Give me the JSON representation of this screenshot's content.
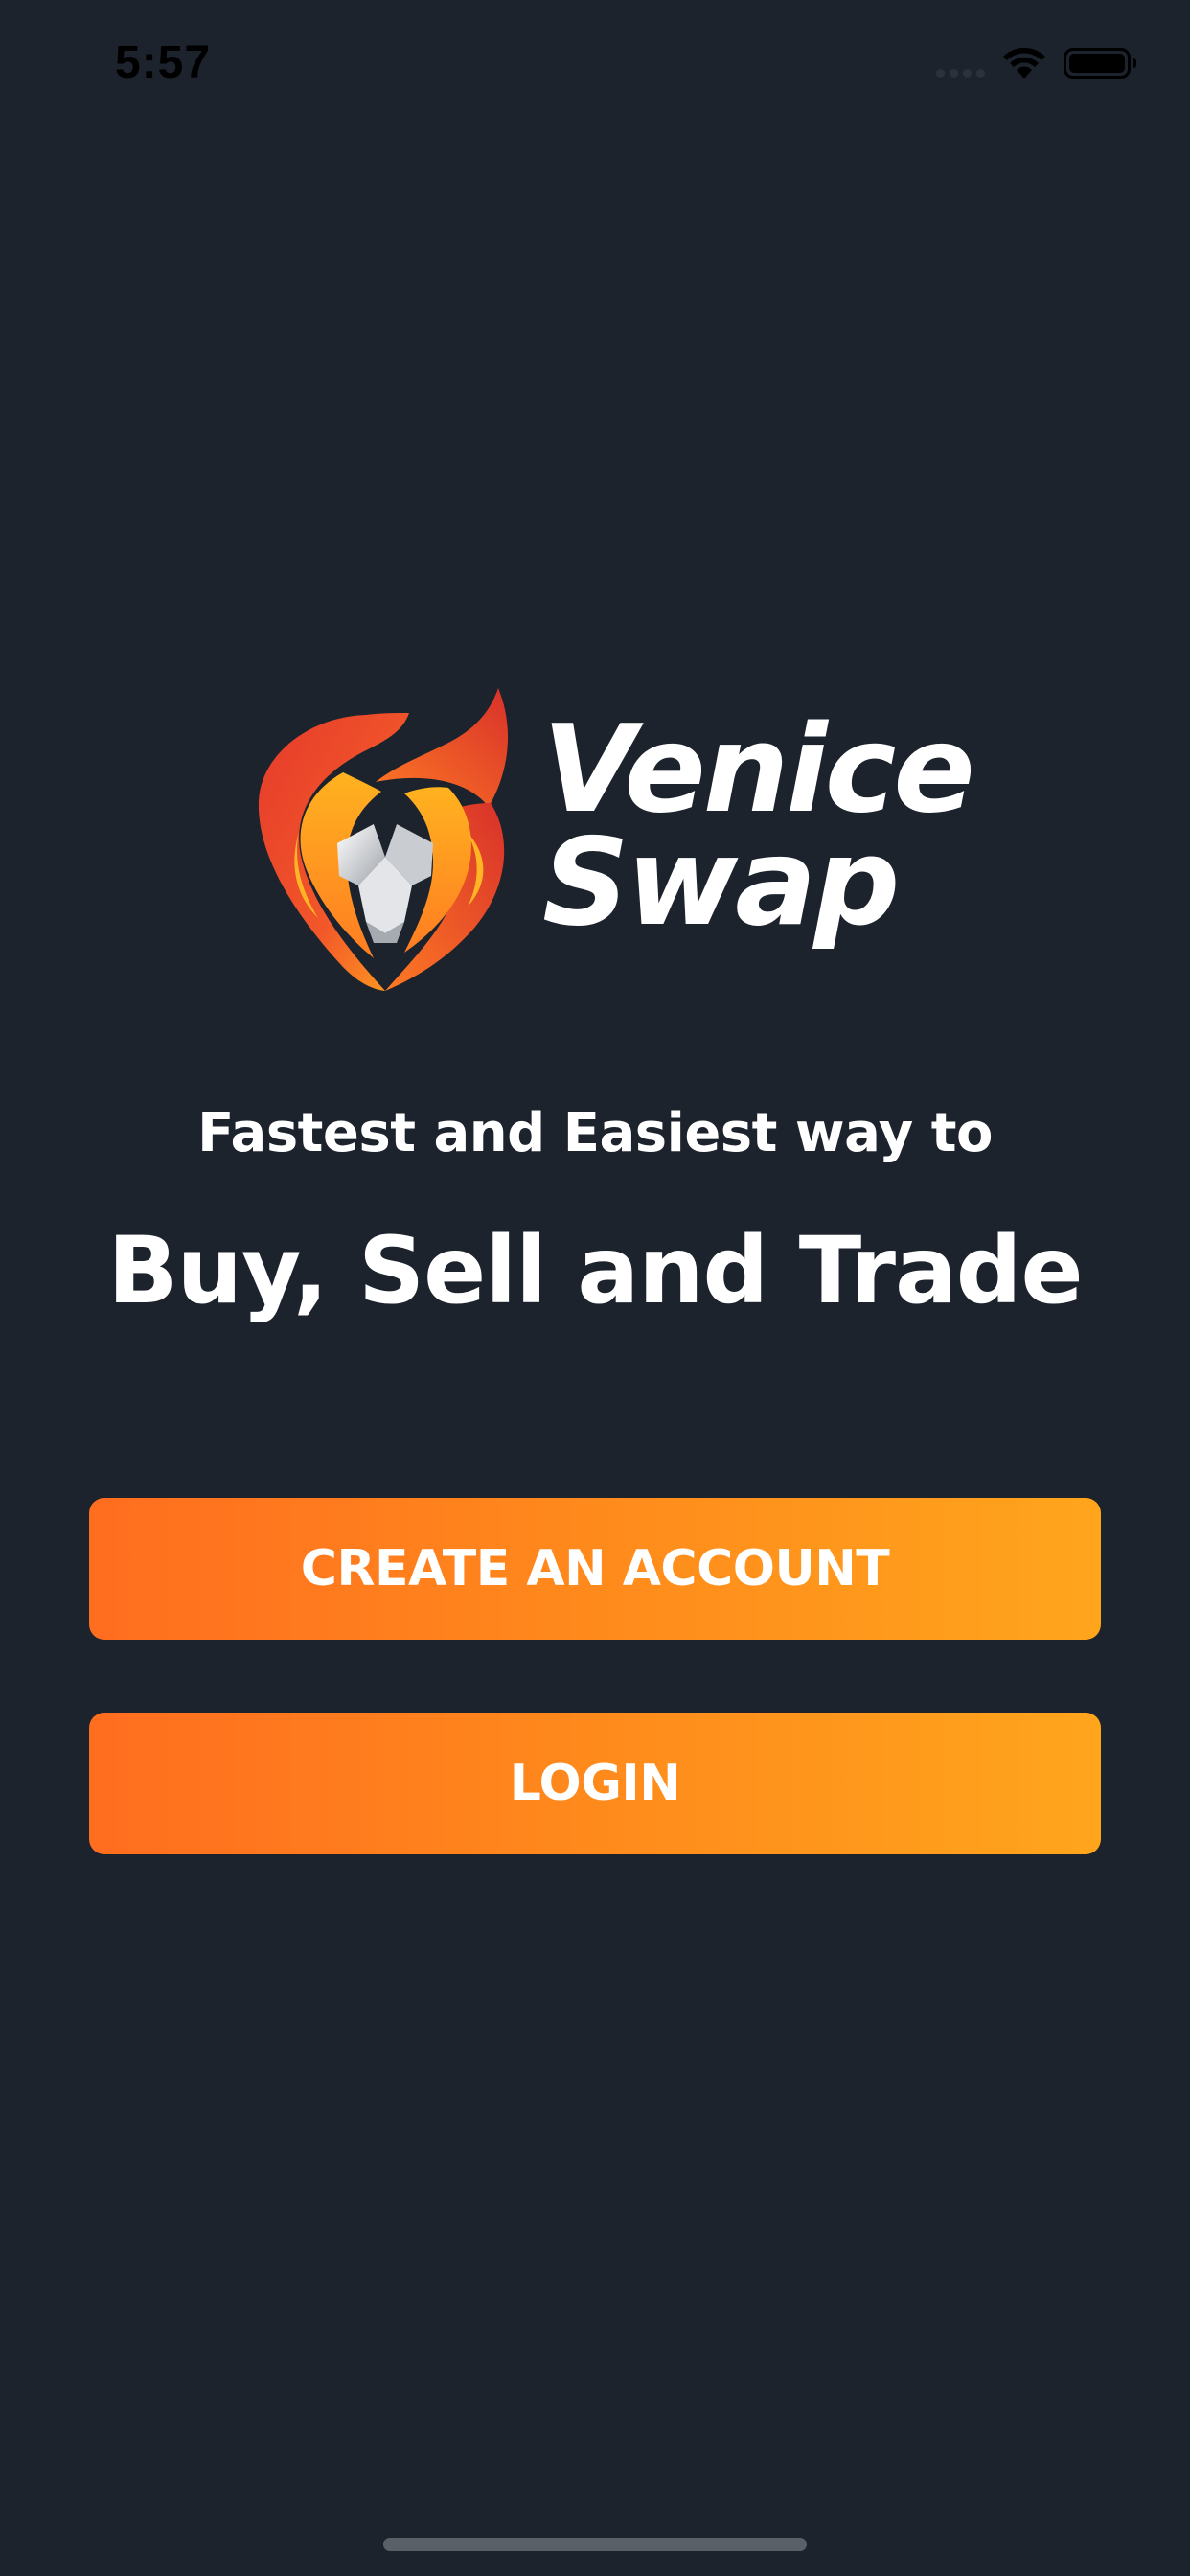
{
  "status_bar": {
    "time": "5:57",
    "icons": [
      "cellular-signal-icon",
      "wifi-icon",
      "battery-icon"
    ]
  },
  "logo": {
    "icon": "lion-flame-icon",
    "line1": "Venice",
    "line2": "Swap"
  },
  "tagline": "Fastest and Easiest way to",
  "headline": "Buy, Sell and Trade",
  "buttons": {
    "create_account": "CREATE AN ACCOUNT",
    "login": "LOGIN"
  },
  "colors": {
    "background": "#1c232c",
    "button_gradient_start": "#ff6d1f",
    "button_gradient_end": "#ffa51c",
    "text": "#ffffff"
  }
}
